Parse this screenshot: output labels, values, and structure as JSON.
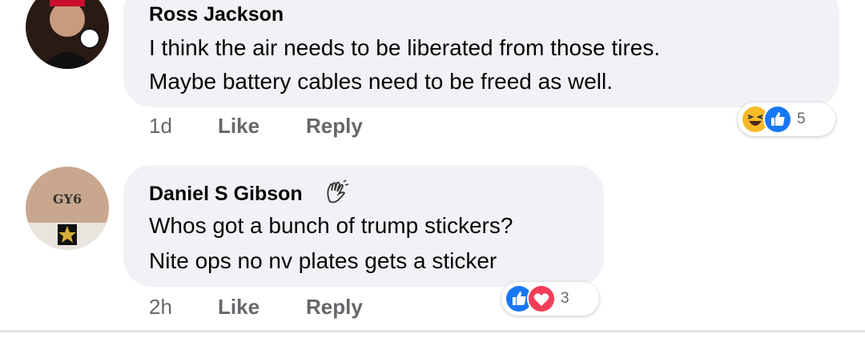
{
  "comments": [
    {
      "author": "Ross Jackson",
      "lines": [
        "I think the air needs to be liberated from those tires.",
        "Maybe battery cables need to be freed as well."
      ],
      "time": "1d",
      "like_label": "Like",
      "reply_label": "Reply",
      "reactions": [
        "haha-icon",
        "like-icon"
      ],
      "reaction_count": "5"
    },
    {
      "author": "Daniel S Gibson",
      "badge_icon": "waving-hand-icon",
      "lines": [
        "Whos got a bunch of trump stickers?",
        "Nite ops no nv plates gets a sticker"
      ],
      "time": "2h",
      "like_label": "Like",
      "reply_label": "Reply",
      "reactions": [
        "like-icon",
        "love-icon"
      ],
      "reaction_count": "3",
      "avatar_text": "GY6"
    }
  ],
  "colors": {
    "bubble": "#f0f2f5",
    "like_blue": "#1877f2",
    "love_red": "#f33e58",
    "haha_yellow": "#f7b928"
  }
}
